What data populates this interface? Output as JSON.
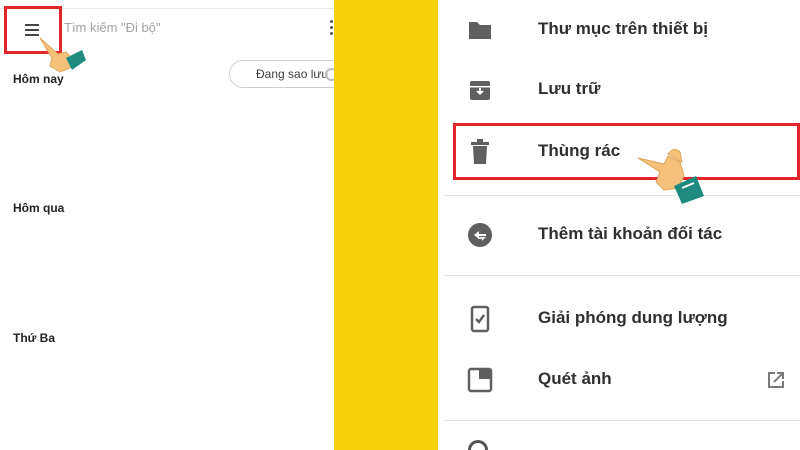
{
  "left": {
    "search_placeholder": "Tìm kiếm \"Đi bộ\"",
    "backup_chip": "Đang sao lưu",
    "sections": [
      "Hôm nay",
      "Hôm qua",
      "Thứ Ba"
    ],
    "icons": {
      "menu": "hamburger-menu-icon",
      "more": "more-vert-icon",
      "pointer": "hand-pointer-icon"
    }
  },
  "right": {
    "items": [
      {
        "label": "Thư mục trên thiết bị",
        "icon": "folder-icon"
      },
      {
        "label": "Lưu trữ",
        "icon": "archive-icon"
      },
      {
        "label": "Thùng rác",
        "icon": "trash-icon"
      },
      {
        "label": "Thêm tài khoản đối tác",
        "icon": "partner-account-icon"
      },
      {
        "label": "Giải phóng dung lượng",
        "icon": "free-up-space-icon"
      },
      {
        "label": "Quét ảnh",
        "icon": "photo-scan-icon"
      }
    ],
    "icons": {
      "external": "open-in-new-icon"
    }
  },
  "colors": {
    "background": "#f9d00c",
    "highlight": "#e2242b",
    "hand_skin": "#f6c27b",
    "cuff": "#1f8a7e"
  }
}
